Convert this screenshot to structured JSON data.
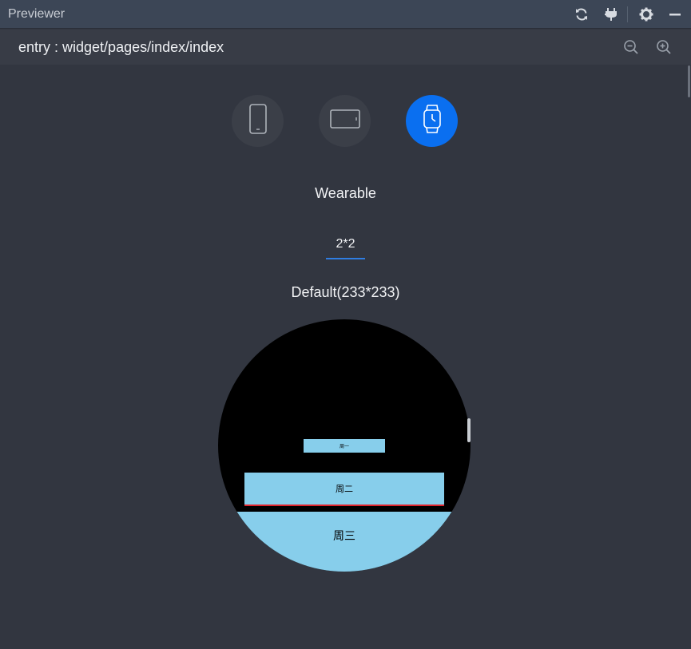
{
  "window": {
    "title": "Previewer"
  },
  "toolbar": {
    "icons": [
      "refresh-icon",
      "plug-icon",
      "gear-icon",
      "minimize-icon"
    ]
  },
  "pathbar": {
    "path": "entry : widget/pages/index/index",
    "icons": [
      "zoom-out-icon",
      "zoom-in-icon"
    ]
  },
  "devices": [
    {
      "icon": "phone-icon",
      "active": false
    },
    {
      "icon": "tablet-icon",
      "active": false
    },
    {
      "icon": "watch-icon",
      "active": true
    }
  ],
  "device_name": "Wearable",
  "size_tab": "2*2",
  "size_caption": "Default(233*233)",
  "watch_items": [
    {
      "label": "周一"
    },
    {
      "label": "周二"
    },
    {
      "label": "周三"
    }
  ],
  "colors": {
    "accent": "#0a6ff0",
    "item_bg": "#87ceeb",
    "item_border": "#e0222a",
    "background": "#323640"
  }
}
